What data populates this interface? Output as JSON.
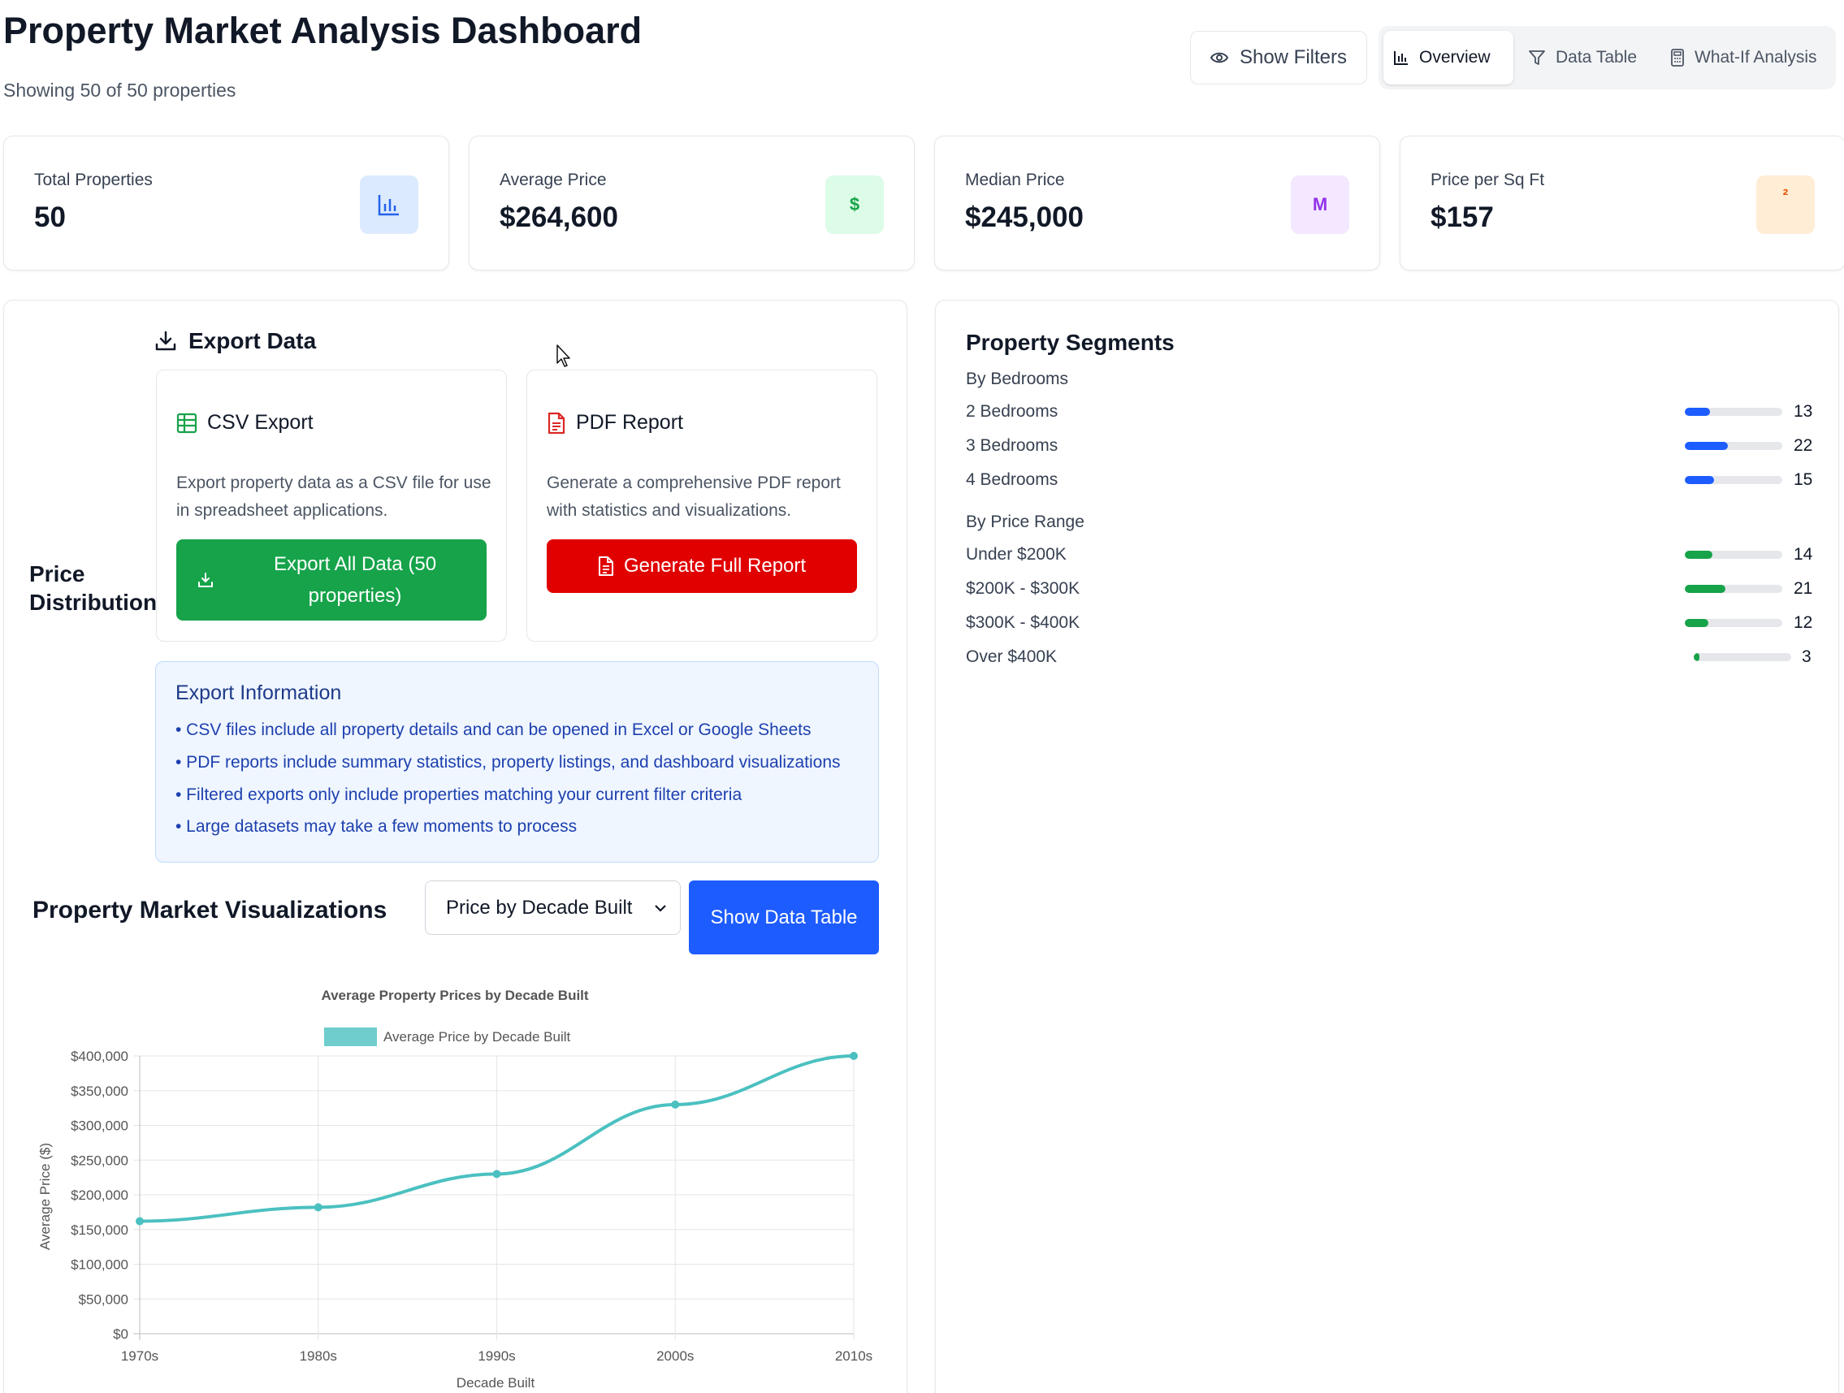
{
  "header": {
    "title": "Property Market Analysis Dashboard",
    "subtitle": "Showing 50 of 50 properties",
    "filters_label": "Show Filters",
    "tabs": [
      {
        "label": "Overview",
        "icon": "bar-chart-icon"
      },
      {
        "label": "Data Table",
        "icon": "filter-icon"
      },
      {
        "label": "What-If Analysis",
        "icon": "calculator-icon"
      }
    ],
    "active_tab": "Overview"
  },
  "stats": [
    {
      "label": "Total Properties",
      "value": "50",
      "icon": "bar-chart-icon",
      "icon_text": "",
      "color": "#2563eb",
      "bg": "#dbeafe"
    },
    {
      "label": "Average Price",
      "value": "$264,600",
      "icon": "dollar-icon",
      "icon_text": "$",
      "color": "#16a34a",
      "bg": "#dcfce7"
    },
    {
      "label": "Median Price",
      "value": "$245,000",
      "icon": "median-icon",
      "icon_text": "M",
      "color": "#9333ea",
      "bg": "#f3e8ff"
    },
    {
      "label": "Price per Sq Ft",
      "value": "$157",
      "icon": "squared-icon",
      "icon_text": "²",
      "color": "#ea580c",
      "bg": "#ffedd5"
    }
  ],
  "price_distribution": {
    "title": "Price Distribution"
  },
  "export": {
    "title": "Export Data",
    "csv": {
      "title": "CSV Export",
      "description": "Export property data as a CSV file for use in spreadsheet applications.",
      "button": "Export All Data (50 properties)"
    },
    "pdf": {
      "title": "PDF Report",
      "description": "Generate a comprehensive PDF report with statistics and visualizations.",
      "button": "Generate Full Report"
    },
    "info": {
      "title": "Export Information",
      "items": [
        "• CSV files include all property details and can be opened in Excel or Google Sheets",
        "• PDF reports include summary statistics, property listings, and dashboard visualizations",
        "• Filtered exports only include properties matching your current filter criteria",
        "• Large datasets may take a few moments to process"
      ]
    }
  },
  "visualizations": {
    "title": "Property Market Visualizations",
    "select_value": "Price by Decade Built",
    "show_table_label": "Show Data Table"
  },
  "chart_data": {
    "type": "line",
    "title": "Average Property Prices by Decade Built",
    "xlabel": "Decade Built",
    "ylabel": "Average Price ($)",
    "categories": [
      "1970s",
      "1980s",
      "1990s",
      "2000s",
      "2010s"
    ],
    "series": [
      {
        "name": "Average Price by Decade Built",
        "values": [
          162000,
          182000,
          230000,
          330000,
          400000
        ],
        "color": "#4bc0c0"
      }
    ],
    "ylim": [
      0,
      400000
    ],
    "yticks": [
      "$0",
      "$50,000",
      "$100,000",
      "$150,000",
      "$200,000",
      "$250,000",
      "$300,000",
      "$350,000",
      "$400,000"
    ],
    "grid": true,
    "legend_position": "top"
  },
  "segments": {
    "title": "Property Segments",
    "groups": [
      {
        "title": "By Bedrooms",
        "color": "#1d5cff",
        "items": [
          {
            "label": "2 Bedrooms",
            "count": "13",
            "fraction": 0.26
          },
          {
            "label": "3 Bedrooms",
            "count": "22",
            "fraction": 0.44
          },
          {
            "label": "4 Bedrooms",
            "count": "15",
            "fraction": 0.3
          }
        ]
      },
      {
        "title": "By Price Range",
        "color": "#16a34a",
        "items": [
          {
            "label": "Under $200K",
            "count": "14",
            "fraction": 0.28
          },
          {
            "label": "$200K - $300K",
            "count": "21",
            "fraction": 0.42
          },
          {
            "label": "$300K - $400K",
            "count": "12",
            "fraction": 0.24
          },
          {
            "label": "Over $400K",
            "count": "3",
            "fraction": 0.06
          }
        ]
      }
    ]
  }
}
